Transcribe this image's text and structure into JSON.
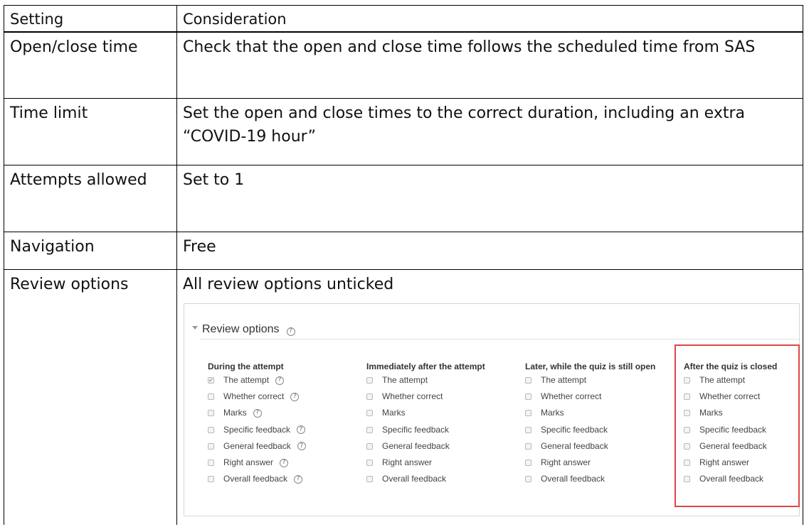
{
  "table": {
    "header": {
      "setting": "Setting",
      "consideration": "Consideration"
    },
    "rows": [
      {
        "setting": "Open/close time",
        "consideration": "Check that the open and close time follows the scheduled time from SAS"
      },
      {
        "setting": "Time limit",
        "consideration": "Set the open and close times to the correct duration, including an extra “COVID-19 hour”"
      },
      {
        "setting": "Attempts allowed",
        "consideration": "Set to 1"
      },
      {
        "setting": "Navigation",
        "consideration": "Free"
      },
      {
        "setting": "Review options",
        "consideration": "All review options unticked"
      }
    ]
  },
  "review": {
    "title": "Review options",
    "help_glyph": "?",
    "columns": [
      {
        "title": "During the attempt",
        "options": [
          {
            "label": "The attempt",
            "checked": true,
            "help": true
          },
          {
            "label": "Whether correct",
            "checked": false,
            "help": true
          },
          {
            "label": "Marks",
            "checked": false,
            "help": true
          },
          {
            "label": "Specific feedback",
            "checked": false,
            "help": true
          },
          {
            "label": "General feedback",
            "checked": false,
            "help": true
          },
          {
            "label": "Right answer",
            "checked": false,
            "help": true
          },
          {
            "label": "Overall feedback",
            "checked": false,
            "help": true
          }
        ]
      },
      {
        "title": "Immediately after the attempt",
        "options": [
          {
            "label": "The attempt",
            "checked": false
          },
          {
            "label": "Whether correct",
            "checked": false
          },
          {
            "label": "Marks",
            "checked": false
          },
          {
            "label": "Specific feedback",
            "checked": false
          },
          {
            "label": "General feedback",
            "checked": false
          },
          {
            "label": "Right answer",
            "checked": false
          },
          {
            "label": "Overall feedback",
            "checked": false
          }
        ]
      },
      {
        "title": "Later, while the quiz is still open",
        "options": [
          {
            "label": "The attempt",
            "checked": false
          },
          {
            "label": "Whether correct",
            "checked": false
          },
          {
            "label": "Marks",
            "checked": false
          },
          {
            "label": "Specific feedback",
            "checked": false
          },
          {
            "label": "General feedback",
            "checked": false
          },
          {
            "label": "Right answer",
            "checked": false
          },
          {
            "label": "Overall feedback",
            "checked": false
          }
        ]
      },
      {
        "title": "After the quiz is closed",
        "options": [
          {
            "label": "The attempt",
            "checked": false
          },
          {
            "label": "Whether correct",
            "checked": false
          },
          {
            "label": "Marks",
            "checked": false
          },
          {
            "label": "Specific feedback",
            "checked": false
          },
          {
            "label": "General feedback",
            "checked": false
          },
          {
            "label": "Right answer",
            "checked": false
          },
          {
            "label": "Overall feedback",
            "checked": false
          }
        ]
      }
    ],
    "highlight_color": "#e04646"
  }
}
